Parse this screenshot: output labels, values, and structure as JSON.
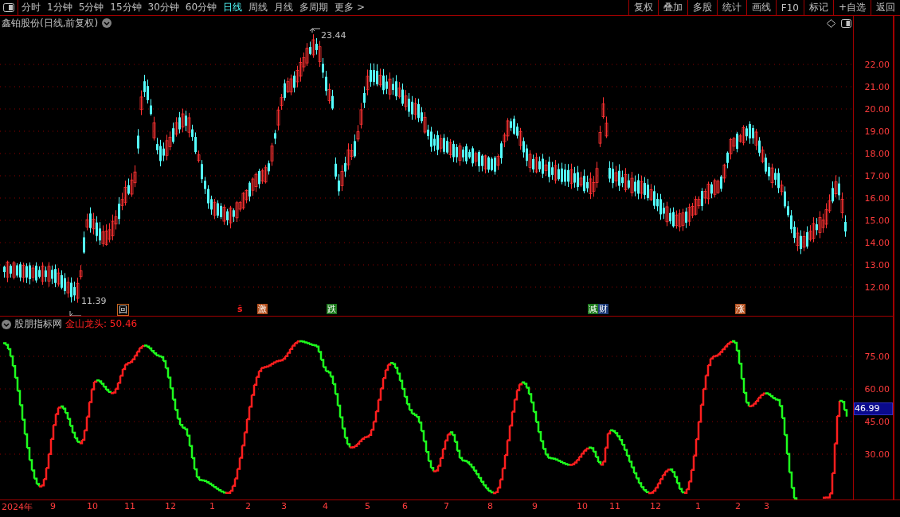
{
  "toolbar": {
    "periods": [
      {
        "label": "分时",
        "selected": false
      },
      {
        "label": "1分钟",
        "selected": false
      },
      {
        "label": "5分钟",
        "selected": false
      },
      {
        "label": "15分钟",
        "selected": false
      },
      {
        "label": "30分钟",
        "selected": false
      },
      {
        "label": "60分钟",
        "selected": false
      },
      {
        "label": "日线",
        "selected": true
      },
      {
        "label": "周线",
        "selected": false
      },
      {
        "label": "月线",
        "selected": false
      },
      {
        "label": "多周期",
        "selected": false
      },
      {
        "label": "更多 >",
        "selected": false
      }
    ],
    "buttons": [
      "复权",
      "叠加",
      "多股",
      "统计",
      "画线",
      "F10",
      "标记",
      "+自选",
      "返回"
    ]
  },
  "main_chart": {
    "title": "鑫铂股份(日线,前复权)",
    "high_label": "23.44",
    "low_label": "11.39",
    "signals": [
      {
        "text": "回",
        "kind": "outline",
        "color": "#c8641e"
      },
      {
        "text": "ŝ",
        "kind": "plain",
        "color": "#ff2020"
      },
      {
        "text": "激",
        "kind": "filled",
        "color": "#b4501e"
      },
      {
        "text": "跌",
        "kind": "filled",
        "color": "#1e7a1e"
      },
      {
        "text": "减",
        "kind": "filled",
        "color": "#1e7a1e"
      },
      {
        "text": "财",
        "kind": "filled",
        "color": "#1e3c78"
      },
      {
        "text": "涨",
        "kind": "filled",
        "color": "#b4501e"
      }
    ]
  },
  "price_axis": [
    "22.00",
    "21.00",
    "20.00",
    "19.00",
    "18.00",
    "17.00",
    "16.00",
    "15.00",
    "14.00",
    "13.00",
    "12.00"
  ],
  "indicator": {
    "name": "股朋指标网",
    "reading": "金山龙头: 50.46",
    "axis": [
      "75.00",
      "60.00",
      "45.00",
      "30.00"
    ],
    "current_value": "46.99"
  },
  "time_axis": [
    "2024年",
    "9",
    "10",
    "11",
    "12",
    "1",
    "2",
    "3",
    "4",
    "5",
    "6",
    "7",
    "8",
    "9",
    "10",
    "11",
    "12",
    "1",
    "2",
    "3"
  ]
}
